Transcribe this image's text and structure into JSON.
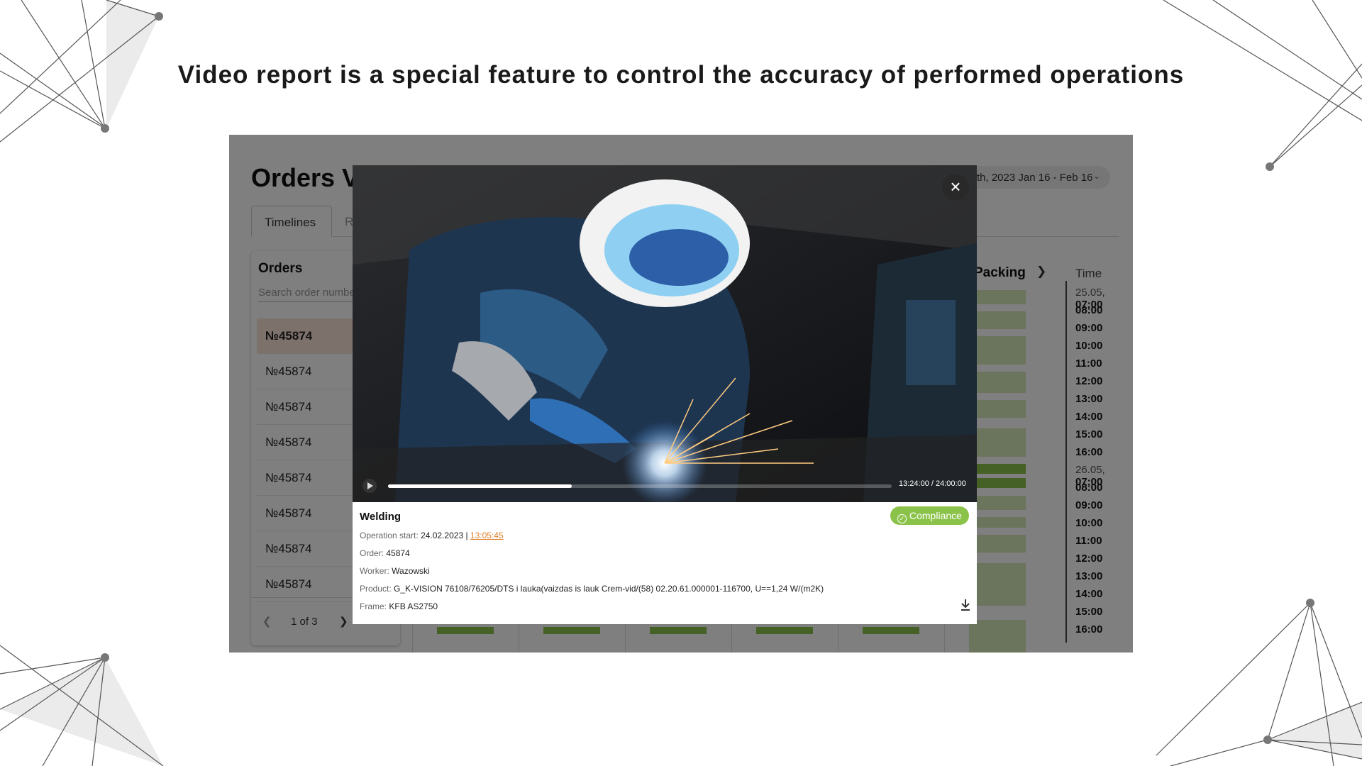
{
  "headline": "Video report is a special feature to control the accuracy of performed operations",
  "app": {
    "title": "Orders V",
    "date_range": "th, 2023 Jan 16 - Feb 16",
    "tabs": [
      "Timelines",
      "R"
    ],
    "orders": {
      "title": "Orders",
      "search_placeholder": "Search order numbe",
      "items": [
        "№45874",
        "№45874",
        "№45874",
        "№45874",
        "№45874",
        "№45874",
        "№45874",
        "№45874"
      ],
      "selected_index": 0,
      "pager_label": "1 of 3"
    },
    "timeline": {
      "stage_label": "Packing",
      "time_header": "Time",
      "times": [
        {
          "day": "25.05,",
          "time": "07:00"
        },
        {
          "day": "",
          "time": "08:00"
        },
        {
          "day": "",
          "time": "09:00"
        },
        {
          "day": "",
          "time": "10:00"
        },
        {
          "day": "",
          "time": "11:00"
        },
        {
          "day": "",
          "time": "12:00"
        },
        {
          "day": "",
          "time": "13:00"
        },
        {
          "day": "",
          "time": "14:00"
        },
        {
          "day": "",
          "time": "15:00"
        },
        {
          "day": "",
          "time": "16:00"
        },
        {
          "day": "26.05,",
          "time": "07:00"
        },
        {
          "day": "",
          "time": "08:00"
        },
        {
          "day": "",
          "time": "09:00"
        },
        {
          "day": "",
          "time": "10:00"
        },
        {
          "day": "",
          "time": "11:00"
        },
        {
          "day": "",
          "time": "12:00"
        },
        {
          "day": "",
          "time": "13:00"
        },
        {
          "day": "",
          "time": "14:00"
        },
        {
          "day": "",
          "time": "15:00"
        },
        {
          "day": "",
          "time": "16:00"
        }
      ]
    }
  },
  "modal": {
    "video": {
      "timecode": "13:24:00 / 24:00:00",
      "progress_fraction": 0.365
    },
    "operation": "Welding",
    "status_badge": "Compliance",
    "operation_start_key": "Operation start:",
    "operation_start_date": "24.02.2023 |",
    "operation_start_time": "13:05:45",
    "order_key": "Order:",
    "order_value": "45874",
    "worker_key": "Worker:",
    "worker_value": "Wazowski",
    "product_key": "Product:",
    "product_value": "G_K-VISION 76108/76205/DTS i lauka(vaizdas is lauk Crem-vid/(58) 02.20.61.000001-116700, U==1,24 W/(m2K)",
    "frame_key": "Frame:",
    "frame_value": "KFB AS2750"
  },
  "colors": {
    "compliance": "#8bc34a",
    "selected_row": "#fbe3d7",
    "link": "#e0802a",
    "bar_light": "#d6e8b8",
    "bar_dark": "#8bc34a"
  }
}
